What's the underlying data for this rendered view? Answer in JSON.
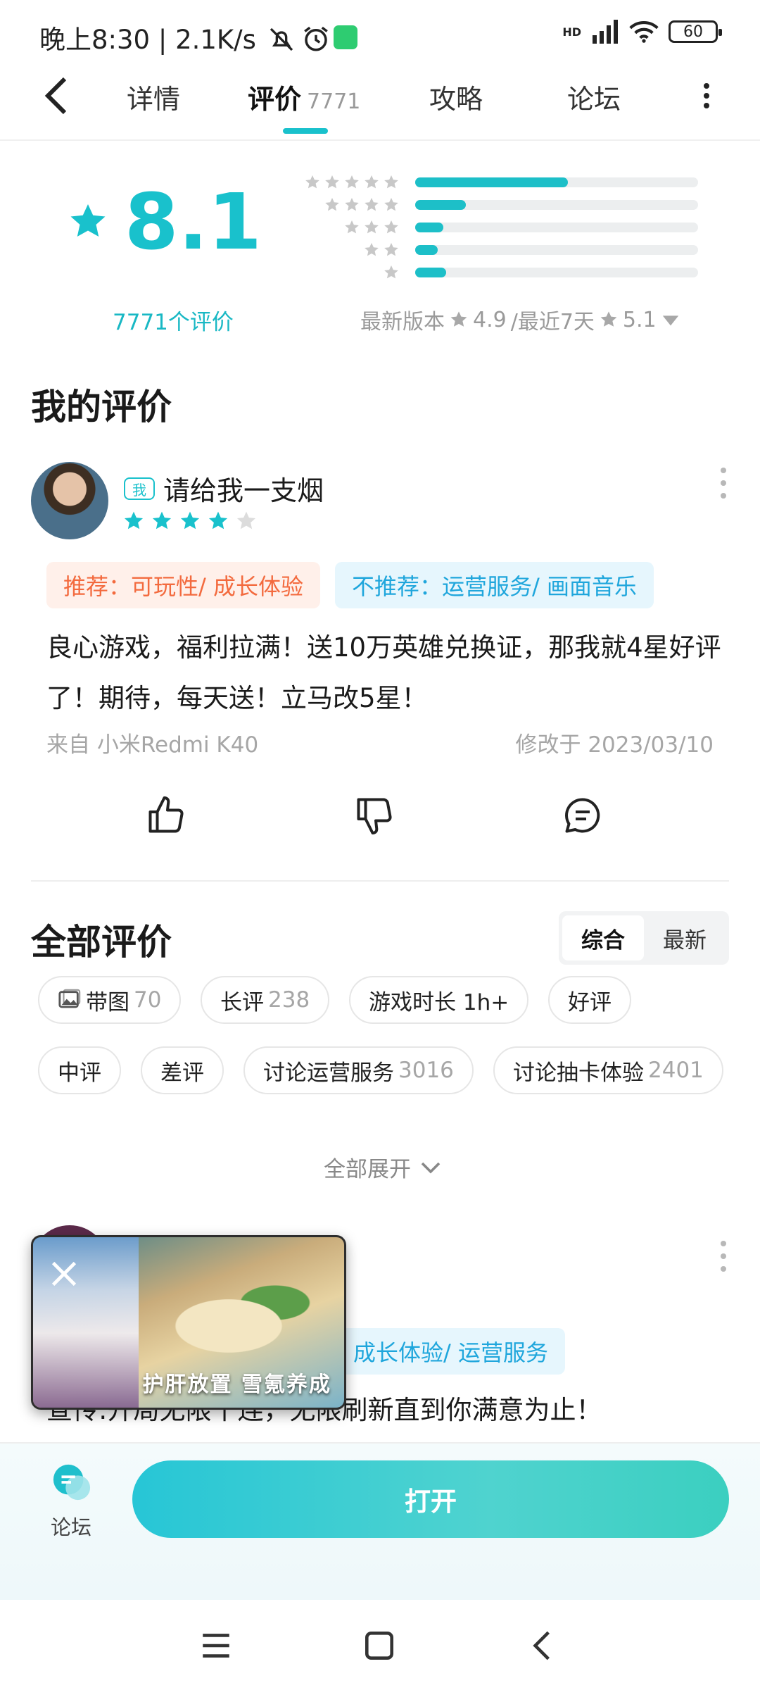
{
  "status_bar": {
    "time": "晚上8:30 | 2.1K/s",
    "network": "HD",
    "battery": "60"
  },
  "tabs": [
    {
      "label": "详情"
    },
    {
      "label": "评价",
      "count": "7771"
    },
    {
      "label": "攻略"
    },
    {
      "label": "论坛"
    }
  ],
  "rating": {
    "score": "8.1",
    "count_label": "7771个评价",
    "recent_prefix": "最新版本",
    "latest_version_score": "4.9",
    "recent_mid": "/最近7天",
    "recent7_score": "5.1",
    "distribution": [
      {
        "stars": 5,
        "fraction": 0.54
      },
      {
        "stars": 4,
        "fraction": 0.18
      },
      {
        "stars": 3,
        "fraction": 0.1
      },
      {
        "stars": 2,
        "fraction": 0.08
      },
      {
        "stars": 1,
        "fraction": 0.11
      }
    ]
  },
  "my_review": {
    "section_title": "我的评价",
    "me_badge": "我",
    "username": "请给我一支烟",
    "stars": 4,
    "recommend_tag": "推荐：可玩性/ 成长体验",
    "not_recommend_tag": "不推荐：运营服务/ 画面音乐",
    "text": "良心游戏，福利拉满！送10万英雄兑换证，那我就4星好评了！期待，每天送！立马改5星！",
    "device": "来自 小米Redmi K40",
    "modified": "修改于 2023/03/10"
  },
  "all_reviews": {
    "section_title": "全部评价",
    "sort_options": [
      "综合",
      "最新"
    ],
    "filters_row1": [
      {
        "label": "带图",
        "count": "70",
        "icon": "image-icon"
      },
      {
        "label": "长评",
        "count": "238"
      },
      {
        "label": "游戏时长 1h+",
        "count": ""
      },
      {
        "label": "好评",
        "count": ""
      }
    ],
    "filters_row2": [
      {
        "label": "中评",
        "count": ""
      },
      {
        "label": "差评",
        "count": ""
      },
      {
        "label": "讨论运营服务",
        "count": "3016"
      },
      {
        "label": "讨论抽卡体验",
        "count": "2401"
      }
    ],
    "expand_label": "全部展开",
    "second_review": {
      "tag": "成长体验/ 运营服务",
      "text": "宣传:开局无限十连，无限刷新直到你满意为止！"
    }
  },
  "popup": {
    "caption": "护肝放置 雪氪养成"
  },
  "bottom": {
    "forum_label": "论坛",
    "open_label": "打开"
  },
  "colors": {
    "accent": "#19c1cc",
    "recommend": "#f36a3e",
    "not_recommend": "#1fa6dc"
  }
}
